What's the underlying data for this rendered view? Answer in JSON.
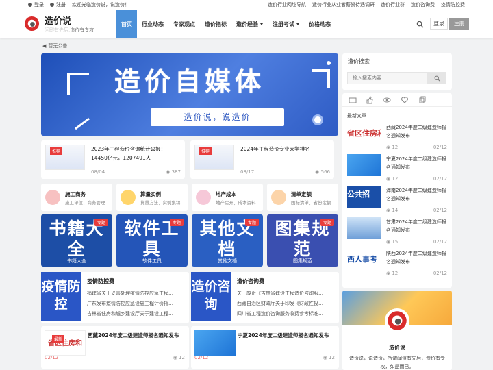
{
  "topbar": {
    "login": "登录",
    "register": "注册",
    "welcome": "欢迎光临造价说，说造价！",
    "links": [
      "造价行业网址导航",
      "造价行业从业者薪资待遇调研",
      "造价行业群",
      "造价咨询费",
      "疫情防控费"
    ]
  },
  "header": {
    "brand": "造价说",
    "slogan_a": "闲暇有先后,",
    "slogan_b": "造价有专攻",
    "nav": [
      "首页",
      "行业动态",
      "专家观点",
      "造价指标",
      "造价经验",
      "注册考试",
      "价格动态"
    ],
    "login": "登录",
    "register": "注册"
  },
  "notice": "暂无公告",
  "banner": {
    "title": "造价自媒体",
    "subtitle": "造价说，说造价"
  },
  "featured": [
    {
      "tag": "推荐",
      "title": "2023年工程造价咨询统计公报：14450亿元，1207491人",
      "date": "08/04",
      "views": "387"
    },
    {
      "tag": "推荐",
      "title": "2024年工程造价专业大学排名",
      "date": "08/17",
      "views": "566"
    }
  ],
  "categories": [
    {
      "name": "施工商务",
      "desc": "施工单位，商务管理",
      "color": "#f7c1c1"
    },
    {
      "name": "算量实例",
      "desc": "算量方法，实例集锦",
      "color": "#ffd56b"
    },
    {
      "name": "地产成本",
      "desc": "地产房开，成本资料",
      "color": "#f6c8d8"
    },
    {
      "name": "清单定额",
      "desc": "国标清单，省份定额",
      "color": "#fcd4a9"
    }
  ],
  "tiles": [
    {
      "tag": "专题",
      "big": "书籍大全",
      "caption": "书籍大全",
      "color": "#1d4ea6"
    },
    {
      "tag": "专题",
      "big": "软件工具",
      "caption": "软件工具",
      "color": "#2455b8"
    },
    {
      "tag": "专题",
      "big": "其他文档",
      "caption": "其他文档",
      "color": "#2a5fc2"
    },
    {
      "tag": "专题",
      "big": "图集规范",
      "caption": "图集规范",
      "color": "#3a4fb0"
    }
  ],
  "sections": [
    {
      "title": "疫情防控费",
      "big": "疫情防控",
      "lines": [
        "福建省关于妥善处理疫情防控应急工程…",
        "广东发布疫情防控应急设施工程计价指…",
        "吉林省住房和城乡建设厅关于建设工程…"
      ]
    },
    {
      "title": "造价咨询费",
      "big": "造价咨询",
      "lines": [
        "关于废止《吉林省建设工程造价咨询服…",
        "西藏自治区财政厅关于印发《财政性投…",
        "四川省工程造价咨询服务收费参考标准…"
      ]
    }
  ],
  "posts": [
    {
      "tag": "最新",
      "title": "西藏2024年度二级建造师报名通知发布",
      "date": "02/12",
      "views": "12",
      "thumb": "省区住房和"
    },
    {
      "title": "宁夏2024年度二级建造师报名通知发布",
      "date": "02/12",
      "views": "12"
    }
  ],
  "sidebar": {
    "search_title": "造价搜索",
    "search_placeholder": "输入搜索内容",
    "latest": "最新文章",
    "items": [
      {
        "title": "西藏2024年度二级建造师报名通知发布",
        "views": "12",
        "date": "02/12",
        "thumb": "省区住房和"
      },
      {
        "title": "宁夏2024年度二级建造师报名通知发布",
        "views": "12",
        "date": "02/12"
      },
      {
        "title": "海南2024年度二级建造师报名通知发布",
        "views": "14",
        "date": "02/12",
        "thumb": "公共招"
      },
      {
        "title": "甘肃2024年度二级建造师报名通知发布",
        "views": "15",
        "date": "02/12"
      },
      {
        "title": "陕西2024年度二级建造师报名通知发布",
        "views": "12",
        "date": "02/12",
        "thumb": "西人事考"
      }
    ],
    "about_name": "造价说",
    "about_desc": "造价说，说造价，所谓闻道有先后，造价有专攻，如是而已。"
  }
}
